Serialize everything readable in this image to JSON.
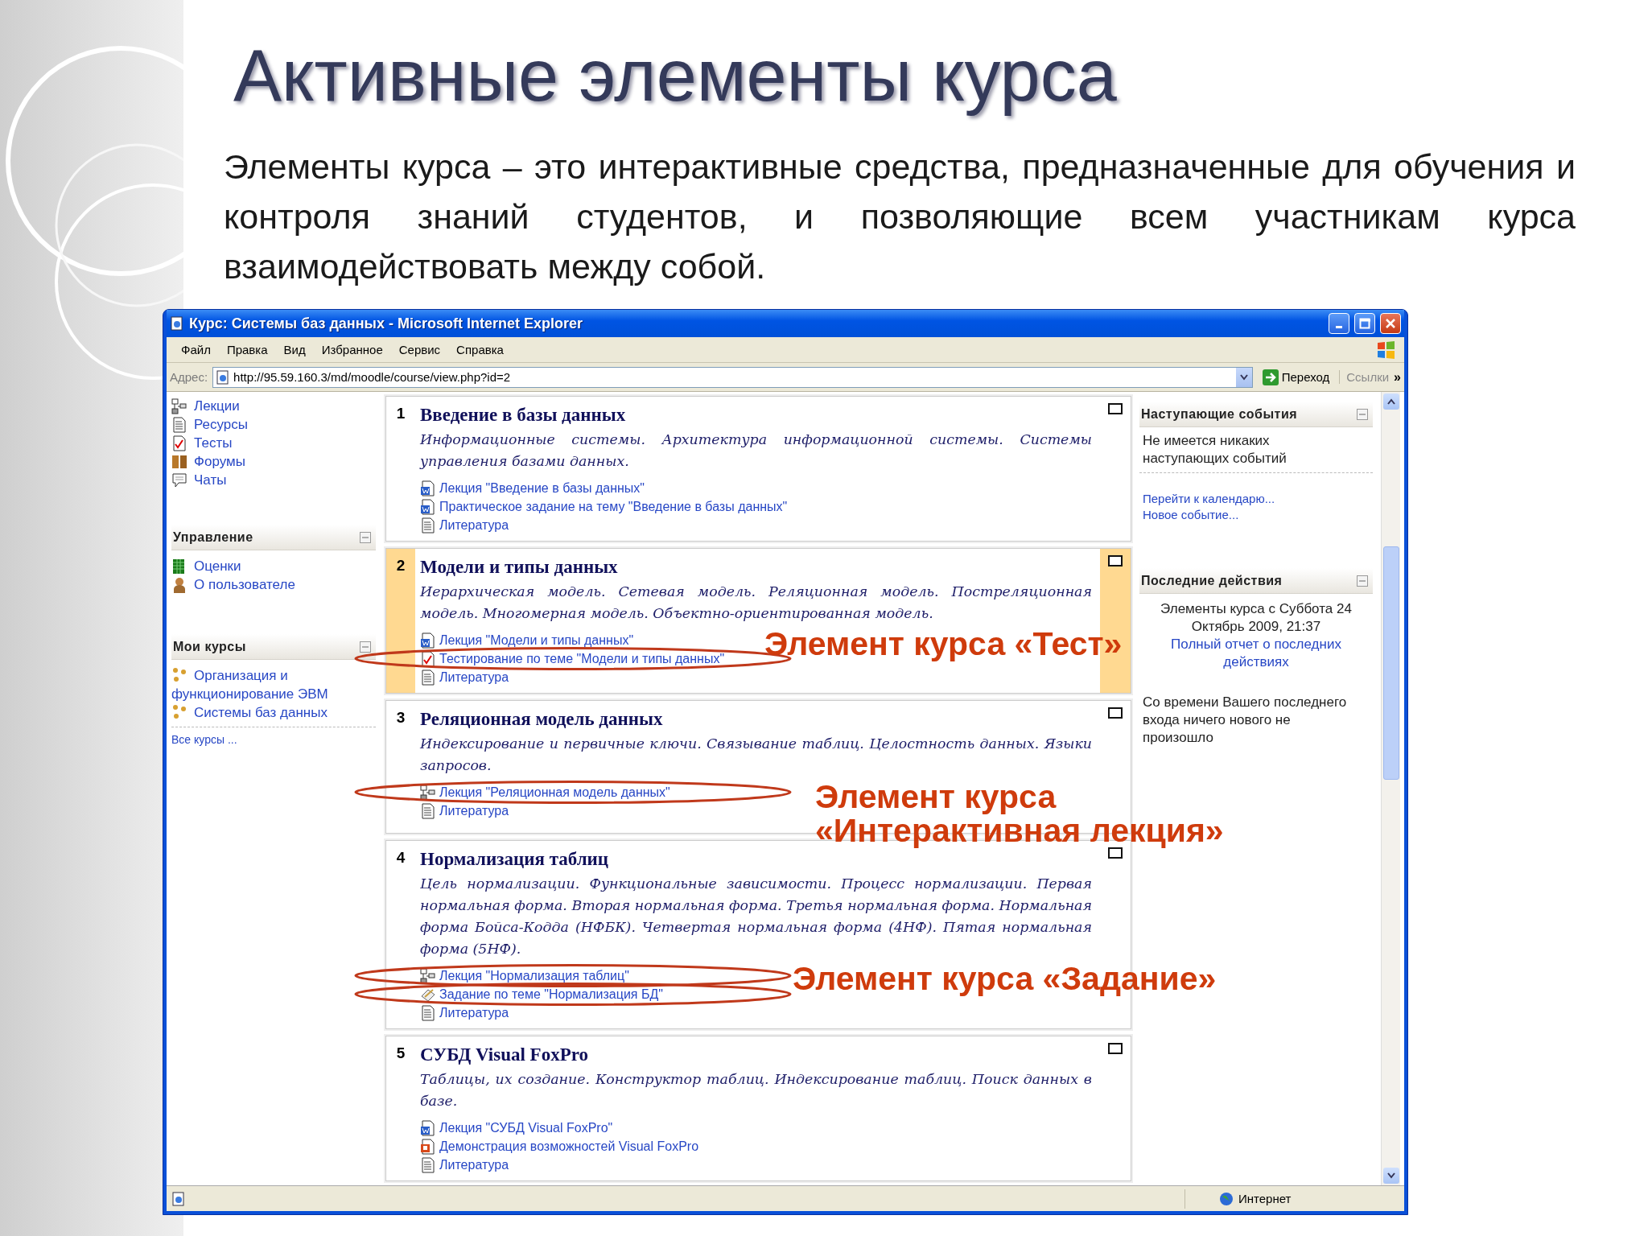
{
  "slide": {
    "title": "Активные элементы курса",
    "paragraph": "Элементы курса – это интерактивные средства, предназначенные для обучения и контроля знаний студентов, и позволяющие всем участникам курса взаимодействовать между собой."
  },
  "browser": {
    "title": "Курс: Системы баз данных - Microsoft Internet Explorer",
    "menu": [
      "Файл",
      "Правка",
      "Вид",
      "Избранное",
      "Сервис",
      "Справка"
    ],
    "address_label": "Адрес:",
    "address": "http://95.59.160.3/md/moodle/course/view.php?id=2",
    "go_button": "Переход",
    "links_button": "Ссылки",
    "more": "»",
    "status_zone": "Интернет"
  },
  "activities": [
    {
      "kind": "lecture",
      "label": "Лекции"
    },
    {
      "kind": "resource",
      "label": "Ресурсы"
    },
    {
      "kind": "quiz",
      "label": "Тесты"
    },
    {
      "kind": "forum",
      "label": "Форумы"
    },
    {
      "kind": "chat",
      "label": "Чаты"
    }
  ],
  "left_blocks": [
    {
      "title": "Управление",
      "items": [
        {
          "kind": "grades",
          "label": "Оценки"
        },
        {
          "kind": "user",
          "label": "О пользователе"
        }
      ]
    },
    {
      "title": "Мои курсы",
      "items": [
        {
          "kind": "course",
          "label": "Организация и функционирование ЭВМ"
        },
        {
          "kind": "course",
          "label": "Системы баз данных"
        }
      ],
      "footer": "Все курсы ..."
    }
  ],
  "sections": [
    {
      "number": "1",
      "title": "Введение в базы данных",
      "highlighted": false,
      "summary": "Информационные системы. Архитектура информационной системы. Системы управления базами данных.",
      "items": [
        {
          "kind": "word",
          "label": "Лекция \"Введение в базы данных\""
        },
        {
          "kind": "word",
          "label": "Практическое задание на тему \"Введение в базы данных\""
        },
        {
          "kind": "resource",
          "label": "Литература"
        }
      ]
    },
    {
      "number": "2",
      "title": "Модели и типы данных",
      "highlighted": true,
      "summary": "Иерархическая модель. Сетевая модель. Реляционная модель. Постреляционная модель. Многомерная модель. Объектно-ориентированная модель.",
      "items": [
        {
          "kind": "word",
          "label": "Лекция \"Модели и типы данных\""
        },
        {
          "kind": "quiz",
          "label": "Тестирование по теме \"Модели и типы данных\""
        },
        {
          "kind": "resource",
          "label": "Литература"
        }
      ]
    },
    {
      "number": "3",
      "title": "Реляционная модель данных",
      "highlighted": false,
      "summary": "Индексирование и первичные ключи. Связывание таблиц. Целостность данных. Языки запросов.",
      "items": [
        {
          "kind": "lecture",
          "label": "Лекция \"Реляционная модель данных\""
        },
        {
          "kind": "resource",
          "label": "Литература"
        }
      ]
    },
    {
      "number": "4",
      "title": "Нормализация таблиц",
      "highlighted": false,
      "summary": "Цель нормализации. Функциональные зависимости. Процесс нормализации. Первая нормальная форма. Вторая нормальная форма. Третья нормальная форма. Нормальная форма Бойса-Кодда (НФБК). Четвертая нормальная форма (4НФ). Пятая нормальная форма (5НФ).",
      "items": [
        {
          "kind": "lecture",
          "label": "Лекция \"Нормализация таблиц\""
        },
        {
          "kind": "assignment",
          "label": "Задание по теме \"Нормализация БД\""
        },
        {
          "kind": "resource",
          "label": "Литература"
        }
      ]
    },
    {
      "number": "5",
      "title": "СУБД Visual FoxPro",
      "highlighted": false,
      "summary": "Таблицы, их создание. Конструктор таблиц. Индексирование таблиц. Поиск данных в базе.",
      "items": [
        {
          "kind": "word",
          "label": "Лекция \"СУБД Visual FoxPro\""
        },
        {
          "kind": "presentation",
          "label": "Демонстрация возможностей Visual FoxPro"
        },
        {
          "kind": "resource",
          "label": "Литература"
        }
      ]
    }
  ],
  "upcoming": {
    "title": "Наступающие события",
    "text": "Не имеется никаких наступающих событий",
    "links": [
      "Перейти к календарю...",
      "Новое событие..."
    ]
  },
  "recent": {
    "title": "Последние действия",
    "text": "Элементы курса с Суббота 24 Октябрь 2009, 21:37",
    "link": "Полный отчет о последних действиях",
    "note": "Со времени Вашего последнего входа ничего нового не произошло"
  },
  "annotations": [
    {
      "text": "Элемент курса «Тест»"
    },
    {
      "text": "Элемент курса «Интерактивная лекция»"
    },
    {
      "text": "Элемент курса «Задание»"
    }
  ]
}
